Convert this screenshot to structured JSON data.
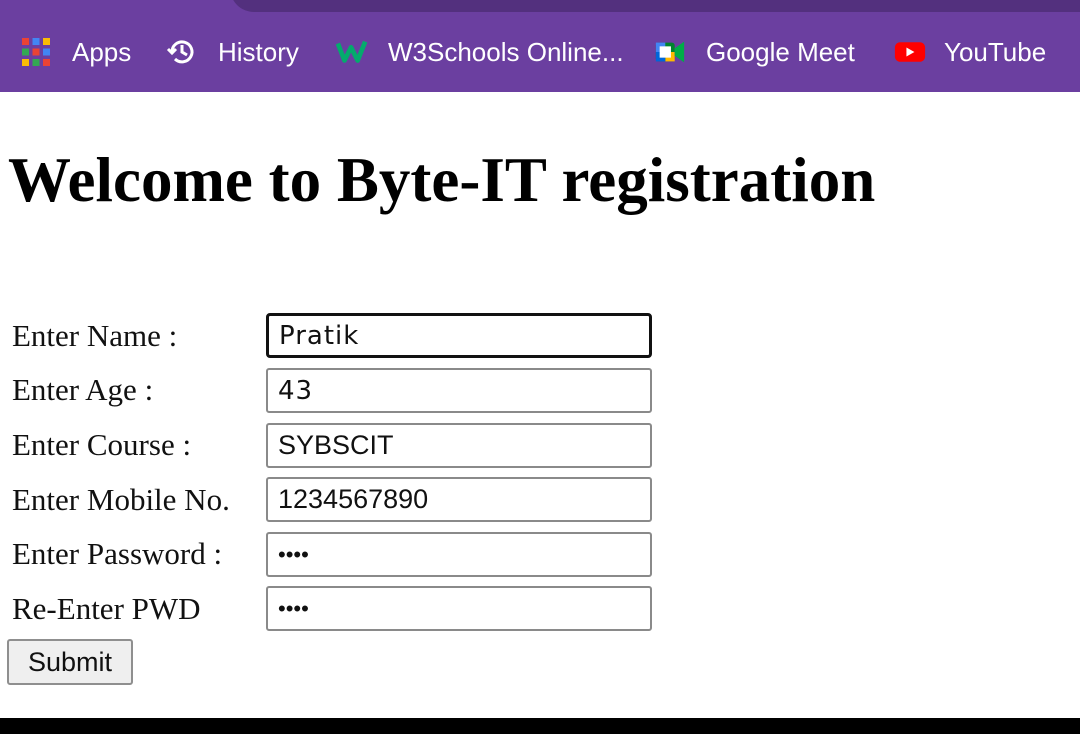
{
  "browser": {
    "bookmarks": [
      {
        "label": "Apps",
        "icon": "apps-grid-icon"
      },
      {
        "label": "History",
        "icon": "history-clock-icon"
      },
      {
        "label": "W3Schools Online...",
        "icon": "w3schools-icon"
      },
      {
        "label": "Google Meet",
        "icon": "google-meet-icon"
      },
      {
        "label": "YouTube",
        "icon": "youtube-icon"
      }
    ],
    "colors": {
      "bookmarks_bar": "#6b3fa0",
      "youtube_red": "#ff0000",
      "w3schools_green": "#04aa6d"
    }
  },
  "page": {
    "title": "Welcome to Byte-IT registration"
  },
  "form": {
    "fields": [
      {
        "label": "Enter Name :",
        "value": "Pratik",
        "type": "text",
        "focused": true
      },
      {
        "label": "Enter Age :",
        "value": "43",
        "type": "text"
      },
      {
        "label": "Enter Course :",
        "value": "SYBSCIT",
        "type": "text"
      },
      {
        "label": "Enter Mobile No.",
        "value": "1234567890",
        "type": "text"
      },
      {
        "label": "Enter Password :",
        "value": "pass",
        "type": "password"
      },
      {
        "label": "Re-Enter PWD",
        "value": "pass",
        "type": "password"
      }
    ],
    "submit_label": "Submit"
  }
}
